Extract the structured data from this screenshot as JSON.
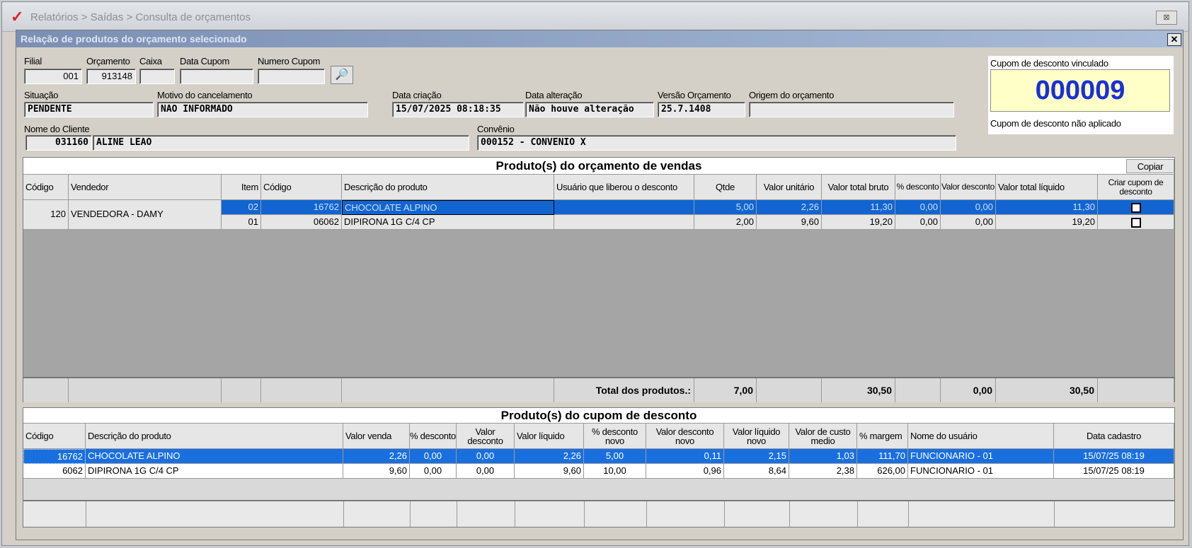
{
  "outer_window": {
    "title": "Relatórios > Saídas > Consulta de orçamentos",
    "button": "⊠"
  },
  "dialog": {
    "title": "Relação de produtos do orçamento selecionado",
    "close": "✕"
  },
  "form": {
    "filial": {
      "label": "Filial",
      "value": "001"
    },
    "orcamento": {
      "label": "Orçamento",
      "value": "913148"
    },
    "caixa": {
      "label": "Caixa",
      "value": ""
    },
    "data_cupom": {
      "label": "Data Cupom",
      "value": ""
    },
    "numero_cupom": {
      "label": "Numero Cupom",
      "value": ""
    },
    "situacao": {
      "label": "Situação",
      "value": "PENDENTE"
    },
    "motivo": {
      "label": "Motivo do cancelamento",
      "value": "NAO INFORMADO"
    },
    "data_criacao": {
      "label": "Data criação",
      "value": "15/07/2025 08:18:35"
    },
    "data_alteracao": {
      "label": "Data alteração",
      "value": "Não houve alteração"
    },
    "versao": {
      "label": "Versão Orçamento",
      "value": "25.7.1408"
    },
    "origem": {
      "label": "Origem do orçamento",
      "value": ""
    },
    "cliente": {
      "label": "Nome do Cliente",
      "code": "031160",
      "name": "ALINE LEAO"
    },
    "convenio": {
      "label": "Convênio",
      "value": "000152 - CONVENIO X"
    }
  },
  "coupon": {
    "linked_label": "Cupom de desconto vinculado",
    "number": "000009",
    "status": "Cupom de desconto não aplicado"
  },
  "products_grid": {
    "title": "Produto(s) do orçamento de vendas",
    "copy_button": "Copiar",
    "headers": [
      "Código",
      "Vendedor",
      "Item",
      "Código",
      "Descrição do produto",
      "Usuário que liberou o  desconto",
      "Qtde",
      "Valor unitário",
      "Valor total bruto",
      "% desconto",
      "Valor desconto",
      "Valor total líquido",
      "Criar cupom de desconto"
    ],
    "seller": {
      "code": "120",
      "name": "VENDEDORA - DAMY"
    },
    "rows": [
      {
        "item": "02",
        "code": "16762",
        "desc": "CHOCOLATE ALPINO",
        "user": "",
        "qtde": "5,00",
        "unit": "2,26",
        "bruto": "11,30",
        "pct": "0,00",
        "desc_val": "0,00",
        "liquido": "11,30"
      },
      {
        "item": "01",
        "code": "06062",
        "desc": "DIPIRONA  1G C/4 CP",
        "user": "",
        "qtde": "2,00",
        "unit": "9,60",
        "bruto": "19,20",
        "pct": "0,00",
        "desc_val": "0,00",
        "liquido": "19,20"
      }
    ],
    "totals": {
      "label": "Total dos produtos.:",
      "qtde": "7,00",
      "bruto": "30,50",
      "desc_val": "0,00",
      "liquido": "30,50"
    }
  },
  "coupon_grid": {
    "title": "Produto(s) do cupom de desconto",
    "headers": [
      "Código",
      "Descrição do produto",
      "Valor venda",
      "% desconto",
      "Valor desconto",
      "Valor líquido",
      "% desconto novo",
      "Valor desconto novo",
      "Valor líquido novo",
      "Valor de custo medio",
      "% margem",
      "Nome do usuário",
      "Data cadastro"
    ],
    "rows": [
      {
        "code": "16762",
        "desc": "CHOCOLATE ALPINO",
        "venda": "2,26",
        "pct": "0,00",
        "desc_val": "0,00",
        "liquido": "2,26",
        "pct_novo": "5,00",
        "desc_novo": "0,11",
        "liq_novo": "2,15",
        "custo": "1,03",
        "margem": "111,70",
        "user": "FUNCIONARIO - 01",
        "data": "15/07/25 08:19"
      },
      {
        "code": "6062",
        "desc": "DIPIRONA  1G C/4 CP",
        "venda": "9,60",
        "pct": "0,00",
        "desc_val": "0,00",
        "liquido": "9,60",
        "pct_novo": "10,00",
        "desc_novo": "0,96",
        "liq_novo": "8,64",
        "custo": "2,38",
        "margem": "626,00",
        "user": "FUNCIONARIO - 01",
        "data": "15/07/25 08:19"
      }
    ]
  },
  "icons": {
    "app": "check-icon",
    "search": "magnifier-icon",
    "close": "close-icon"
  }
}
